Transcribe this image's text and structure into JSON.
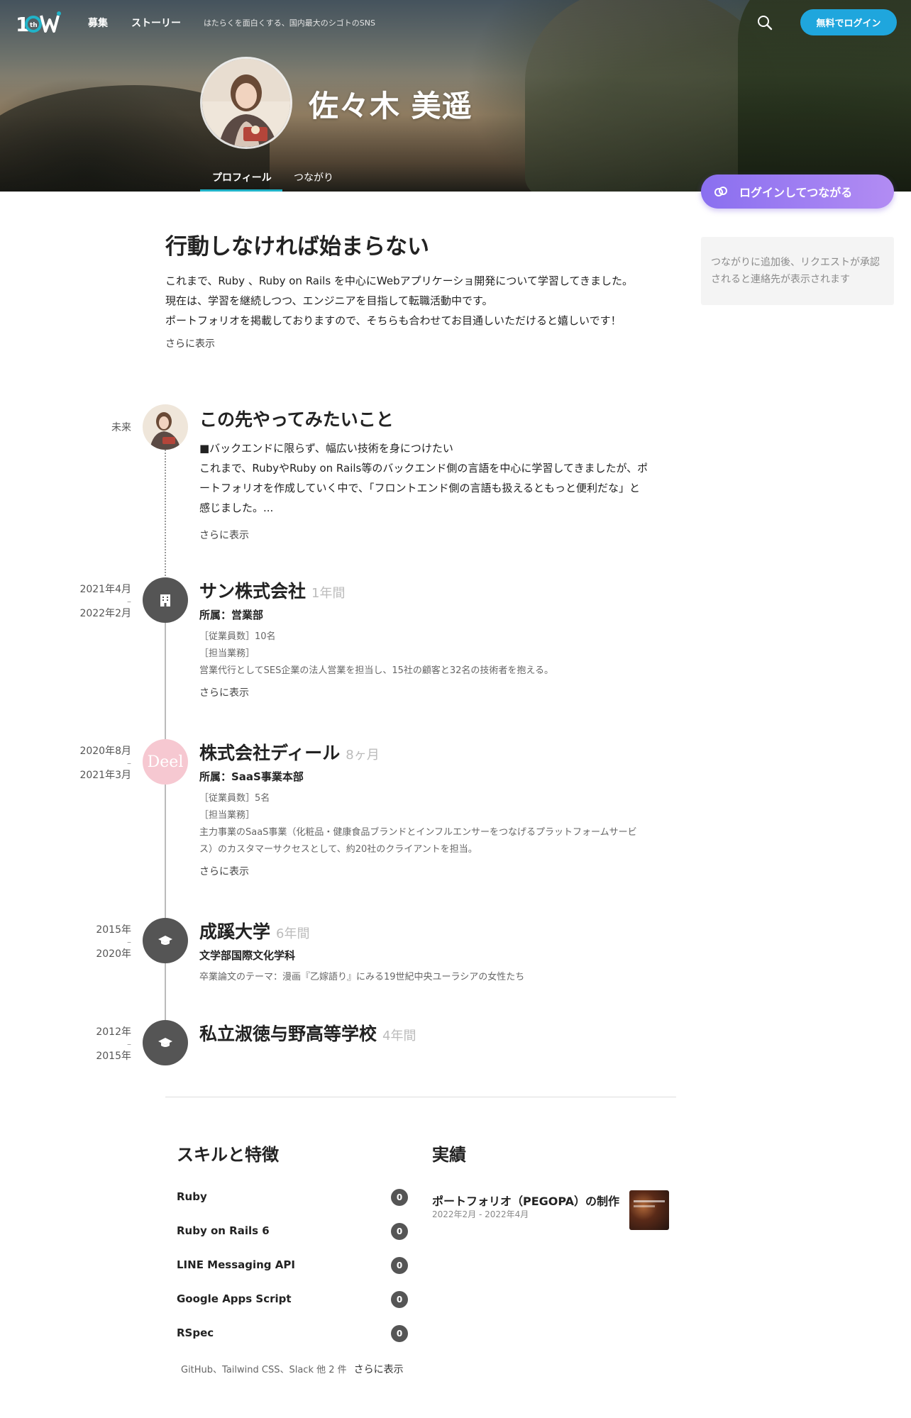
{
  "header": {
    "logo_text": "10th",
    "nav": [
      "募集",
      "ストーリー"
    ],
    "tagline": "はたらくを面白くする、国内最大のシゴトのSNS",
    "login_label": "無料でログイン"
  },
  "profile": {
    "name": "佐々木 美遥",
    "tabs": [
      "プロフィール",
      "つながり"
    ]
  },
  "sidebar": {
    "connect_label": "ログインしてつながる",
    "notice": "つながりに追加後、リクエストが承認されると連絡先が表示されます"
  },
  "intro": {
    "headline": "行動しなければ始まらない",
    "lines": [
      "これまで、Ruby 、Ruby on Rails を中心にWebアプリケーショ開発について学習してきました。",
      "現在は、学習を継続しつつ、エンジニアを目指して転職活動中です。",
      "ポートフォリオを掲載しておりますので、そちらも合わせてお目通しいただけると嬉しいです！"
    ],
    "more": "さらに表示"
  },
  "timeline": {
    "future": {
      "label": "未来",
      "title": "この先やってみたいこと",
      "body": [
        "■バックエンドに限らず、幅広い技術を身につけたい",
        "これまで、RubyやRuby on Rails等のバックエンド側の言語を中心に学習してきましたが、ポ",
        "ートフォリオを作成していく中で、「フロントエンド側の言語も扱えるともっと便利だな」と",
        "感じました。..."
      ],
      "more": "さらに表示"
    },
    "entries": [
      {
        "start": "2021年4月",
        "dash": "–",
        "end": "2022年2月",
        "title": "サン株式会社",
        "duration": "1年間",
        "sub": "所属：営業部",
        "meta": [
          "［従業員数］10名",
          "［担当業務］",
          "営業代行としてSES企業の法人営業を担当し、15社の顧客と32名の技術者を抱える。"
        ],
        "more": "さらに表示",
        "icon": "building-icon"
      },
      {
        "start": "2020年8月",
        "dash": "–",
        "end": "2021年3月",
        "title": "株式会社ディール",
        "duration": "8ヶ月",
        "sub": "所属：SaaS事業本部",
        "meta": [
          "［従業員数］5名",
          "［担当業務］",
          "主力事業のSaaS事業（化粧品・健康食品ブランドとインフルエンサーをつなげるプラットフォームサービ",
          "ス）のカスタマーサクセスとして、約20社のクライアントを担当。"
        ],
        "more": "さらに表示",
        "logo": "Deel"
      },
      {
        "start": "2015年",
        "dash": "–",
        "end": "2020年",
        "title": "成蹊大学",
        "duration": "6年間",
        "sub": "文学部国際文化学科",
        "meta": [
          "卒業論文のテーマ：漫画『乙嫁語り』にみる19世紀中央ユーラシアの女性たち"
        ],
        "icon": "graduation-cap-icon"
      },
      {
        "start": "2012年",
        "dash": "–",
        "end": "2015年",
        "title": "私立淑徳与野高等学校",
        "duration": "4年間",
        "icon": "graduation-cap-icon"
      }
    ]
  },
  "skills": {
    "title": "スキルと特徴",
    "items": [
      {
        "name": "Ruby",
        "count": "0"
      },
      {
        "name": "Ruby on Rails 6",
        "count": "0"
      },
      {
        "name": "LINE Messaging API",
        "count": "0"
      },
      {
        "name": "Google Apps Script",
        "count": "0"
      },
      {
        "name": "RSpec",
        "count": "0"
      }
    ],
    "others": "GitHub、Tailwind CSS、Slack 他 2 件",
    "more": "さらに表示"
  },
  "achievements": {
    "title": "実績",
    "items": [
      {
        "title": "ポートフォリオ（PEGOPA）の制作",
        "date": "2022年2月 - 2022年4月"
      }
    ]
  }
}
